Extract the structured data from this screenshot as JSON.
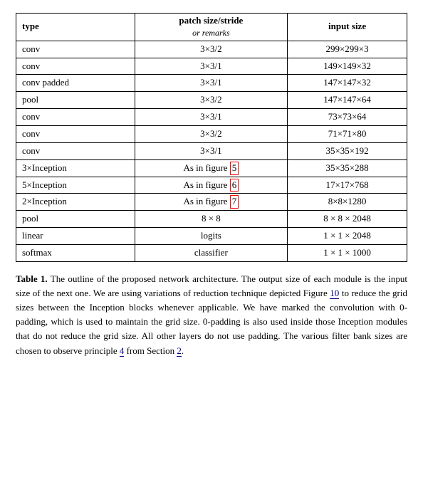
{
  "table": {
    "headers": {
      "col1": "type",
      "col2_main": "patch size/stride",
      "col2_sub": "or remarks",
      "col3": "input size"
    },
    "rows": [
      {
        "type": "conv",
        "patch": "3×3/2",
        "input": "299×299×3"
      },
      {
        "type": "conv",
        "patch": "3×3/1",
        "input": "149×149×32"
      },
      {
        "type": "conv padded",
        "patch": "3×3/1",
        "input": "147×147×32"
      },
      {
        "type": "pool",
        "patch": "3×3/2",
        "input": "147×147×64"
      },
      {
        "type": "conv",
        "patch": "3×3/1",
        "input": "73×73×64"
      },
      {
        "type": "conv",
        "patch": "3×3/2",
        "input": "71×71×80"
      },
      {
        "type": "conv",
        "patch": "3×3/1",
        "input": "35×35×192"
      },
      {
        "type": "3×Inception",
        "patch": "As in figure 5",
        "input": "35×35×288",
        "patch_ref": "5"
      },
      {
        "type": "5×Inception",
        "patch": "As in figure 6",
        "input": "17×17×768",
        "patch_ref": "6"
      },
      {
        "type": "2×Inception",
        "patch": "As in figure 7",
        "input": "8×8×1280",
        "patch_ref": "7"
      },
      {
        "type": "pool",
        "patch": "8 × 8",
        "input": "8 × 8 × 2048"
      },
      {
        "type": "linear",
        "patch": "logits",
        "input": "1 × 1 × 2048"
      },
      {
        "type": "softmax",
        "patch": "classifier",
        "input": "1 × 1 × 1000"
      }
    ]
  },
  "caption": {
    "label": "Table 1.",
    "text": " The outline of the proposed network architecture.  The output size of each module is the input size of the next one.  We are using variations of reduction technique depicted Figure ",
    "ref1": "10",
    "text2": " to reduce the grid sizes between the Inception blocks whenever applicable.  We have marked the convolution with 0-padding, which is used to maintain the grid size.  0-padding is also used inside those Inception modules that do not reduce the grid size.  All other layers do not use padding.  The various filter bank sizes are chosen to observe principle ",
    "ref2": "4",
    "text3": " from Section ",
    "ref3": "2",
    "text4": "."
  }
}
